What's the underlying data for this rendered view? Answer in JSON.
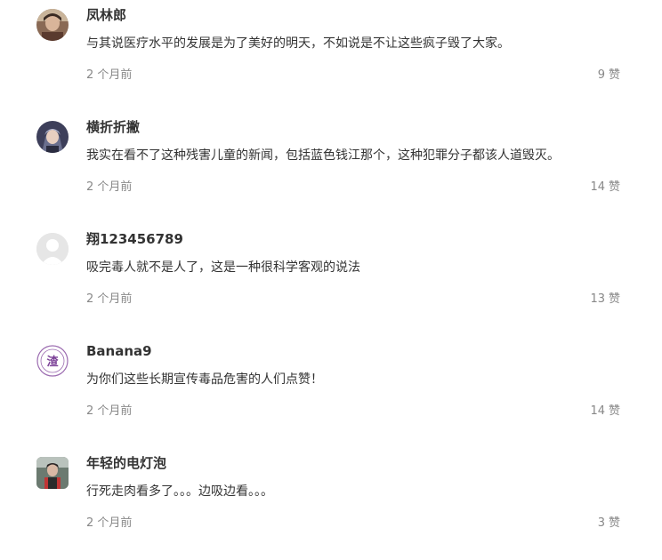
{
  "comments": [
    {
      "username": "凤林郎",
      "text": "与其说医疗水平的发展是为了美好的明天，不如说是不让这些疯子毁了大家。",
      "time": "2 个月前",
      "likes": "9",
      "like_label": "赞",
      "avatar_icon": "portrait-photo-icon"
    },
    {
      "username": "横折折撇",
      "text": "我实在看不了这种残害儿童的新闻，包括蓝色钱江那个，这种犯罪分子都该人道毁灭。",
      "time": "2 个月前",
      "likes": "14",
      "like_label": "赞",
      "avatar_icon": "anime-character-icon"
    },
    {
      "username": "翔123456789",
      "text": "吸完毒人就不是人了，这是一种很科学客观的说法",
      "time": "2 个月前",
      "likes": "13",
      "like_label": "赞",
      "avatar_icon": "default-user-icon"
    },
    {
      "username": "Banana9",
      "text": "为你们这些长期宣传毒品危害的人们点赞！",
      "time": "2 个月前",
      "likes": "14",
      "like_label": "赞",
      "avatar_icon": "seal-stamp-icon",
      "avatar_glyph": "渣"
    },
    {
      "username": "年轻的电灯泡",
      "text": "行死走肉看多了。。。边吸边看。。。",
      "time": "2 个月前",
      "likes": "3",
      "like_label": "赞",
      "avatar_icon": "person-photo-icon"
    }
  ]
}
